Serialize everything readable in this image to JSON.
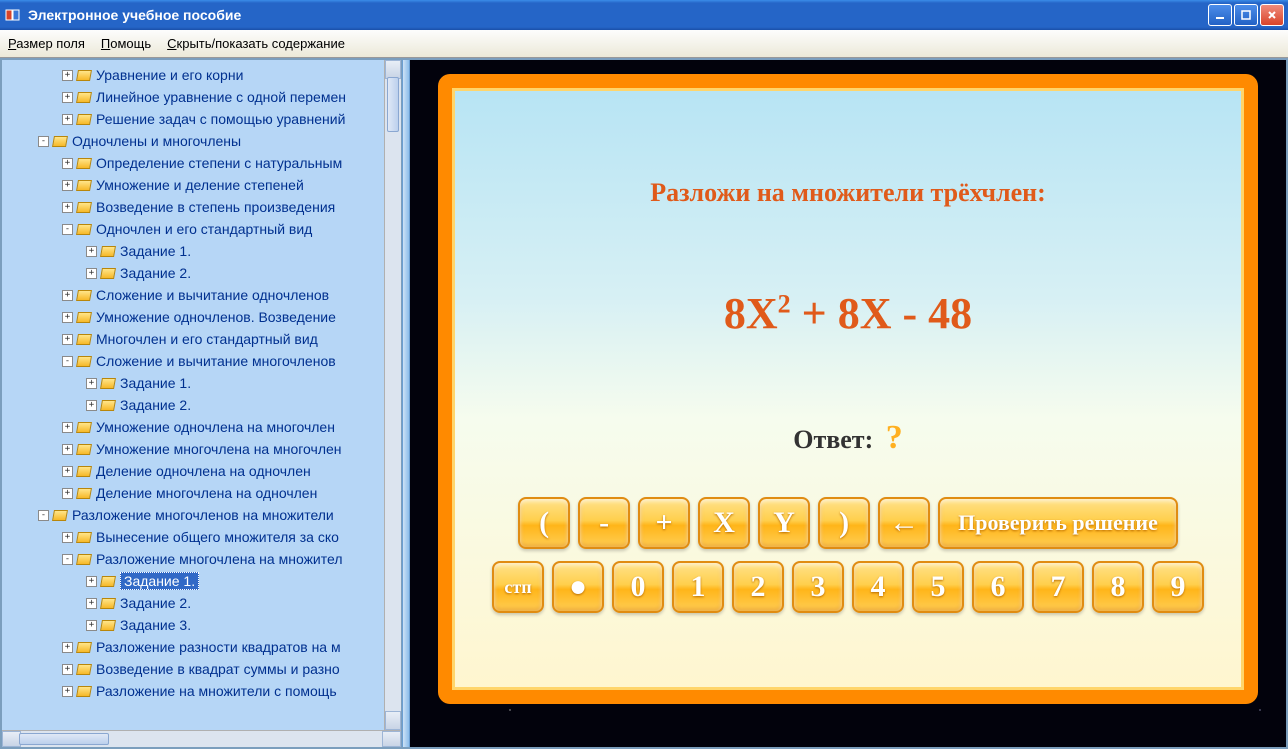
{
  "window": {
    "title": "Электронное учебное пособие"
  },
  "menu": {
    "size": "Размер поля",
    "help": "Помощь",
    "toggle": "Скрыть/показать содержание"
  },
  "tree": [
    {
      "indent": 60,
      "exp": "+",
      "label": "Уравнение и его корни"
    },
    {
      "indent": 60,
      "exp": "+",
      "label": "Линейное уравнение с одной перемен"
    },
    {
      "indent": 60,
      "exp": "+",
      "label": "Решение задач с помощью уравнений"
    },
    {
      "indent": 36,
      "exp": "-",
      "label": "Одночлены и многочлены"
    },
    {
      "indent": 60,
      "exp": "+",
      "label": "Определение степени с натуральным"
    },
    {
      "indent": 60,
      "exp": "+",
      "label": "Умножение и деление степеней"
    },
    {
      "indent": 60,
      "exp": "+",
      "label": "Возведение в степень произведения"
    },
    {
      "indent": 60,
      "exp": "-",
      "label": "Одночлен и его стандартный вид"
    },
    {
      "indent": 84,
      "exp": "+",
      "label": "Задание 1."
    },
    {
      "indent": 84,
      "exp": "+",
      "label": "Задание 2."
    },
    {
      "indent": 60,
      "exp": "+",
      "label": "Сложение и вычитание одночленов"
    },
    {
      "indent": 60,
      "exp": "+",
      "label": "Умножение одночленов. Возведение"
    },
    {
      "indent": 60,
      "exp": "+",
      "label": "Многочлен и его стандартный вид"
    },
    {
      "indent": 60,
      "exp": "-",
      "label": "Сложение и вычитание многочленов"
    },
    {
      "indent": 84,
      "exp": "+",
      "label": "Задание 1."
    },
    {
      "indent": 84,
      "exp": "+",
      "label": "Задание 2."
    },
    {
      "indent": 60,
      "exp": "+",
      "label": "Умножение одночлена на многочлен"
    },
    {
      "indent": 60,
      "exp": "+",
      "label": "Умножение многочлена на многочлен"
    },
    {
      "indent": 60,
      "exp": "+",
      "label": "Деление одночлена на одночлен"
    },
    {
      "indent": 60,
      "exp": "+",
      "label": "Деление многочлена на одночлен"
    },
    {
      "indent": 36,
      "exp": "-",
      "label": "Разложение многочленов на множители"
    },
    {
      "indent": 60,
      "exp": "+",
      "label": "Вынесение общего множителя за ско"
    },
    {
      "indent": 60,
      "exp": "-",
      "label": "Разложение многочлена на множител"
    },
    {
      "indent": 84,
      "exp": "+",
      "label": "Задание 1.",
      "selected": true
    },
    {
      "indent": 84,
      "exp": "+",
      "label": "Задание 2."
    },
    {
      "indent": 84,
      "exp": "+",
      "label": "Задание 3."
    },
    {
      "indent": 60,
      "exp": "+",
      "label": "Разложение разности квадратов на м"
    },
    {
      "indent": 60,
      "exp": "+",
      "label": "Возведение в квадрат суммы и разно"
    },
    {
      "indent": 60,
      "exp": "+",
      "label": "Разложение на множители с помощь"
    }
  ],
  "task": {
    "prompt": "Разложи на множители трёхчлен:",
    "expression_a": "8X",
    "expression_exp": "2",
    "expression_b": " + 8X - 48",
    "answer_label": "Ответ:",
    "answer_placeholder": "?"
  },
  "keys_top": [
    "(",
    "-",
    "+",
    "X",
    "Y",
    ")",
    "←"
  ],
  "check_label": "Проверить решение",
  "keys_bottom": [
    "стп",
    "●",
    "0",
    "1",
    "2",
    "3",
    "4",
    "5",
    "6",
    "7",
    "8",
    "9"
  ]
}
